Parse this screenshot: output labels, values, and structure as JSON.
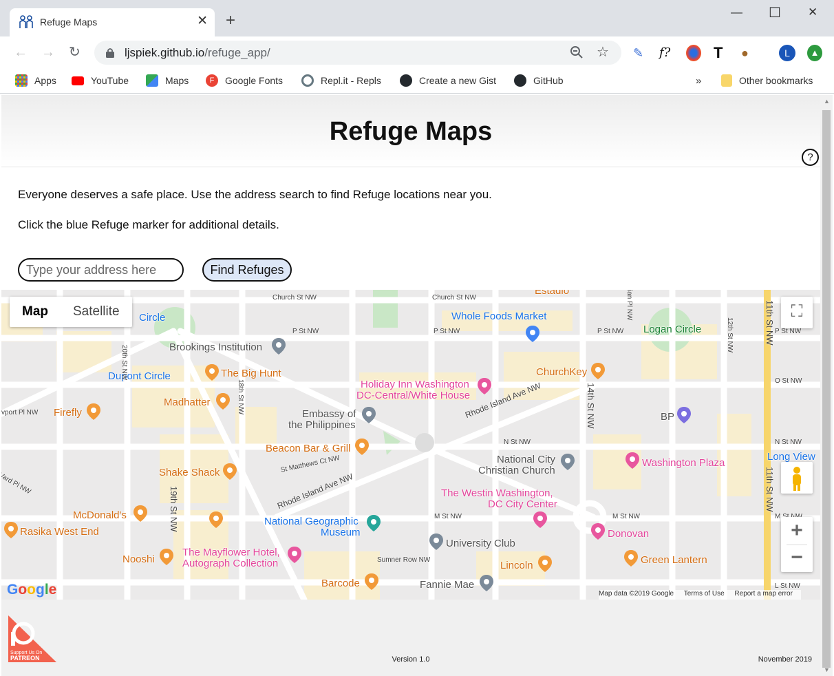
{
  "browser": {
    "tab_title": "Refuge Maps",
    "url_host": "ljspiek.github.io",
    "url_path": "/refuge_app/",
    "bookmarks": [
      {
        "label": "Apps",
        "icon": "apps-grid-icon",
        "color": "#e8453c"
      },
      {
        "label": "YouTube",
        "icon": "youtube-icon",
        "color": "#ff0000"
      },
      {
        "label": "Maps",
        "icon": "google-maps-icon",
        "color": "#34a853"
      },
      {
        "label": "Google Fonts",
        "icon": "google-fonts-icon",
        "color": "#ea4335"
      },
      {
        "label": "Repl.it - Repls",
        "icon": "replit-icon",
        "color": "#667881"
      },
      {
        "label": "Create a new Gist",
        "icon": "github-icon",
        "color": "#24292e"
      },
      {
        "label": "GitHub",
        "icon": "github-icon",
        "color": "#24292e"
      }
    ],
    "overflow": "»",
    "other_bookmarks": "Other bookmarks",
    "profile_initial": "L"
  },
  "page": {
    "title": "Refuge Maps",
    "help": "?",
    "intro_line1": "Everyone deserves a safe place. Use the address search to find Refuge locations near you.",
    "intro_line2": "Click the blue Refuge marker for additional details.",
    "address_placeholder": "Type your address here",
    "find_button": "Find Refuges"
  },
  "map": {
    "type_map": "Map",
    "type_satellite": "Satellite",
    "labels": [
      {
        "text": "Estadio",
        "kind": "poi"
      },
      {
        "text": "Circle",
        "kind": "blue"
      },
      {
        "text": "Whole Foods Market",
        "kind": "blue"
      },
      {
        "text": "Logan Circle",
        "kind": "green"
      },
      {
        "text": "Brookings Institution",
        "kind": "gray"
      },
      {
        "text": "Dupont Circle",
        "kind": "blue"
      },
      {
        "text": "The Big Hunt",
        "kind": "poi"
      },
      {
        "text": "Holiday Inn Washington",
        "kind": "hotel"
      },
      {
        "text": "DC-Central/White House",
        "kind": "hotel"
      },
      {
        "text": "ChurchKey",
        "kind": "poi"
      },
      {
        "text": "Madhatter",
        "kind": "poi"
      },
      {
        "text": "Firefly",
        "kind": "poi"
      },
      {
        "text": "Embassy of",
        "kind": "gray"
      },
      {
        "text": "the Philippines",
        "kind": "gray"
      },
      {
        "text": "BP",
        "kind": "gray"
      },
      {
        "text": "Beacon Bar & Grill",
        "kind": "poi"
      },
      {
        "text": "National City",
        "kind": "gray"
      },
      {
        "text": "Christian Church",
        "kind": "gray"
      },
      {
        "text": "Washington Plaza",
        "kind": "hotel"
      },
      {
        "text": "Long View",
        "kind": "blue"
      },
      {
        "text": "Shake Shack",
        "kind": "poi"
      },
      {
        "text": "The Westin Washington,",
        "kind": "hotel"
      },
      {
        "text": "DC City Center",
        "kind": "hotel"
      },
      {
        "text": "McDonald's",
        "kind": "poi"
      },
      {
        "text": "National Geographic",
        "kind": "blue"
      },
      {
        "text": "Museum",
        "kind": "blue"
      },
      {
        "text": "Donovan",
        "kind": "hotel"
      },
      {
        "text": "Rasika West End",
        "kind": "poi"
      },
      {
        "text": "University Club",
        "kind": "gray"
      },
      {
        "text": "Nooshi",
        "kind": "poi"
      },
      {
        "text": "The Mayflower Hotel,",
        "kind": "hotel"
      },
      {
        "text": "Autograph Collection",
        "kind": "hotel"
      },
      {
        "text": "Lincoln",
        "kind": "poi"
      },
      {
        "text": "Green Lantern",
        "kind": "poi"
      },
      {
        "text": "Barcode",
        "kind": "poi"
      },
      {
        "text": "Fannie Mae",
        "kind": "gray"
      }
    ],
    "streets": [
      "Church St NW",
      "Church St NW",
      "P St NW",
      "P St NW",
      "P St NW",
      "P St NW",
      "20th St NW",
      "18th St NW",
      "14th St NW",
      "12th St NW",
      "11th St NW",
      "11th St NW",
      "O St NW",
      "Rhode Island Ave NW",
      "Rhode Island Ave NW",
      "N St NW",
      "N St NW",
      "St Matthews Ct NW",
      "19th St NW",
      "M St NW",
      "M St NW",
      "M St NW",
      "Sumner Row NW",
      "L St NW",
      "vport Pl NW",
      "Vard Pl NW",
      "ian Pl NW"
    ],
    "attribution": "Map data ©2019 Google",
    "terms": "Terms of Use",
    "report": "Report a map error",
    "google": "Google"
  },
  "footer": {
    "patreon_line1": "Support Us On",
    "patreon_line2": "PATREON",
    "version": "Version 1.0",
    "date": "November 2019"
  }
}
